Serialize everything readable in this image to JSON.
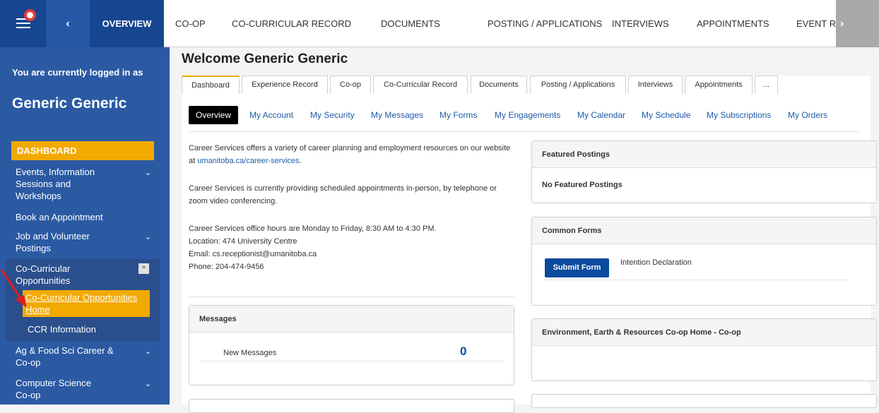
{
  "topbar": {
    "back_label": "‹",
    "overview_label": "OVERVIEW",
    "tabs": [
      "CO-OP",
      "CO-CURRICULAR RECORD",
      "DOCUMENTS",
      "POSTING / APPLICATIONS",
      "INTERVIEWS",
      "APPOINTMENTS",
      "EVENT REG"
    ],
    "scroll_label": "›"
  },
  "sidebar": {
    "login_text": "You are currently logged in as",
    "user_name": "Generic Generic",
    "dashboard_label": "DASHBOARD",
    "items": [
      {
        "label": "Events, Information Sessions and Workshops",
        "chevron": "⌄"
      },
      {
        "label": "Book an Appointment"
      },
      {
        "label": "Job and Volunteer Postings",
        "chevron": "⌄"
      },
      {
        "label": "Co-Curricular Opportunities",
        "chevron": "^"
      },
      {
        "label": "Co-Curricular Opportunities Home"
      },
      {
        "label": "CCR Information"
      },
      {
        "label": "Ag & Food Sci Career & Co-op",
        "chevron": "⌄"
      },
      {
        "label": "Computer Science Co-op",
        "chevron": "⌄"
      }
    ]
  },
  "main": {
    "welcome": "Welcome Generic Generic",
    "tabs": [
      "Dashboard",
      "Experience Record",
      "Co-op",
      "Co-Curricular Record",
      "Documents",
      "Posting / Applications",
      "Interviews",
      "Appointments",
      "..."
    ],
    "subtabs": [
      "Overview",
      "My Account",
      "My Security",
      "My Messages",
      "My Forms",
      "My Engagements",
      "My Calendar",
      "My Schedule",
      "My Subscriptions",
      "My Orders"
    ],
    "intro": {
      "p1_prefix": "Career Services offers a variety of career planning and employment resources on our website at",
      "p1_link": "umanitoba.ca/career-services",
      "p1_suffix": ".",
      "p2": "Career Services is currently providing scheduled appointments in-person, by telephone or zoom video conferencing.",
      "hours": "Career Services office hours are Monday to Friday, 8:30 AM to 4:30 PM.",
      "location": "Location: 474 University Centre",
      "email": "Email: cs.receptionist@umanitoba.ca",
      "phone": "Phone: 204-474-9456"
    },
    "messages": {
      "title": "Messages",
      "row_label": "New Messages",
      "row_count": "0"
    },
    "featured": {
      "title": "Featured Postings",
      "empty": "No Featured Postings"
    },
    "forms": {
      "title": "Common Forms",
      "button": "Submit Form",
      "form_name": "Intention Declaration"
    },
    "env": {
      "title": "Environment, Earth & Resources Co-op Home - Co-op"
    }
  }
}
